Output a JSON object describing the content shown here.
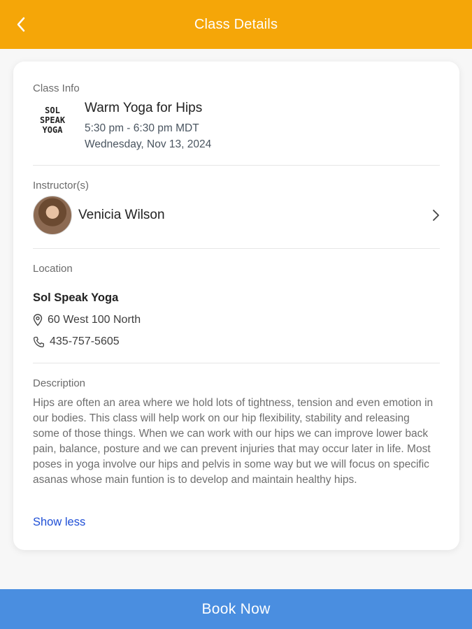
{
  "header": {
    "title": "Class Details",
    "back_icon": "chevron-left-icon",
    "color": "#F5A608"
  },
  "class_info": {
    "label": "Class Info",
    "logo_lines": [
      "SOL",
      "SPEAK",
      "YOGA"
    ],
    "name": "Warm Yoga for Hips",
    "time": "5:30 pm - 6:30 pm MDT",
    "date": "Wednesday, Nov 13, 2024"
  },
  "instructor": {
    "label": "Instructor(s)",
    "name": "Venicia Wilson",
    "chevron_icon": "chevron-right-icon"
  },
  "location": {
    "label": "Location",
    "name": "Sol Speak Yoga",
    "address": "60 West 100 North",
    "phone": "435-757-5605",
    "address_icon": "map-pin-icon",
    "phone_icon": "phone-icon"
  },
  "description": {
    "label": "Description",
    "text": "Hips are often an area where we hold lots of tightness, tension and even emotion in our bodies. This class will help work on our hip flexibility, stability and releasing some of those things. When we can work with our hips we can improve lower back pain, balance, posture and we can prevent injuries that may occur later in life. Most poses in yoga involve our hips and pelvis in some way but we will focus on specific asanas whose main funtion is to develop and maintain healthy hips.",
    "toggle_label": "Show less",
    "link_color": "#1f4fd6"
  },
  "footer": {
    "book_label": "Book Now",
    "color": "#4A8EE0"
  }
}
